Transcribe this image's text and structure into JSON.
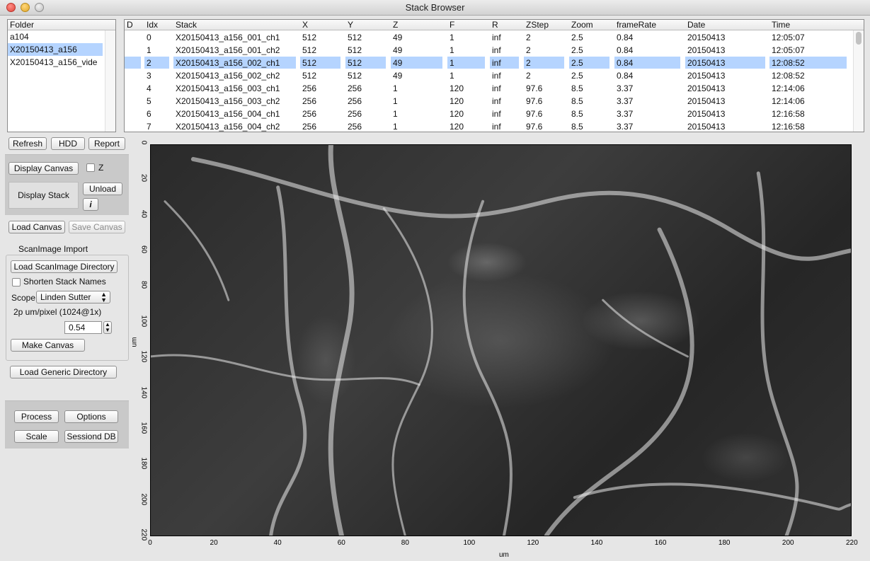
{
  "window": {
    "title": "Stack Browser"
  },
  "folders": {
    "header": "Folder",
    "items": [
      {
        "label": "a104",
        "selected": false
      },
      {
        "label": "X20150413_a156",
        "selected": true
      },
      {
        "label": "X20150413_a156_vide",
        "selected": false
      }
    ]
  },
  "table": {
    "columns": [
      "D",
      "Idx",
      "Stack",
      "X",
      "Y",
      "Z",
      "F",
      "R",
      "ZStep",
      "Zoom",
      "frameRate",
      "Date",
      "Time"
    ],
    "rows": [
      {
        "D": "",
        "Idx": "0",
        "Stack": "X20150413_a156_001_ch1",
        "X": "512",
        "Y": "512",
        "Z": "49",
        "F": "1",
        "R": "inf",
        "ZStep": "2",
        "Zoom": "2.5",
        "frameRate": "0.84",
        "Date": "20150413",
        "Time": "12:05:07",
        "selected": false
      },
      {
        "D": "",
        "Idx": "1",
        "Stack": "X20150413_a156_001_ch2",
        "X": "512",
        "Y": "512",
        "Z": "49",
        "F": "1",
        "R": "inf",
        "ZStep": "2",
        "Zoom": "2.5",
        "frameRate": "0.84",
        "Date": "20150413",
        "Time": "12:05:07",
        "selected": false
      },
      {
        "D": "",
        "Idx": "2",
        "Stack": "X20150413_a156_002_ch1",
        "X": "512",
        "Y": "512",
        "Z": "49",
        "F": "1",
        "R": "inf",
        "ZStep": "2",
        "Zoom": "2.5",
        "frameRate": "0.84",
        "Date": "20150413",
        "Time": "12:08:52",
        "selected": true
      },
      {
        "D": "",
        "Idx": "3",
        "Stack": "X20150413_a156_002_ch2",
        "X": "512",
        "Y": "512",
        "Z": "49",
        "F": "1",
        "R": "inf",
        "ZStep": "2",
        "Zoom": "2.5",
        "frameRate": "0.84",
        "Date": "20150413",
        "Time": "12:08:52",
        "selected": false
      },
      {
        "D": "",
        "Idx": "4",
        "Stack": "X20150413_a156_003_ch1",
        "X": "256",
        "Y": "256",
        "Z": "1",
        "F": "120",
        "R": "inf",
        "ZStep": "97.6",
        "Zoom": "8.5",
        "frameRate": "3.37",
        "Date": "20150413",
        "Time": "12:14:06",
        "selected": false
      },
      {
        "D": "",
        "Idx": "5",
        "Stack": "X20150413_a156_003_ch2",
        "X": "256",
        "Y": "256",
        "Z": "1",
        "F": "120",
        "R": "inf",
        "ZStep": "97.6",
        "Zoom": "8.5",
        "frameRate": "3.37",
        "Date": "20150413",
        "Time": "12:14:06",
        "selected": false
      },
      {
        "D": "",
        "Idx": "6",
        "Stack": "X20150413_a156_004_ch1",
        "X": "256",
        "Y": "256",
        "Z": "1",
        "F": "120",
        "R": "inf",
        "ZStep": "97.6",
        "Zoom": "8.5",
        "frameRate": "3.37",
        "Date": "20150413",
        "Time": "12:16:58",
        "selected": false
      },
      {
        "D": "",
        "Idx": "7",
        "Stack": "X20150413_a156_004_ch2",
        "X": "256",
        "Y": "256",
        "Z": "1",
        "F": "120",
        "R": "inf",
        "ZStep": "97.6",
        "Zoom": "8.5",
        "frameRate": "3.37",
        "Date": "20150413",
        "Time": "12:16:58",
        "selected": false
      }
    ]
  },
  "controls": {
    "refresh": "Refresh",
    "hdd": "HDD",
    "report": "Report",
    "display_canvas": "Display Canvas",
    "z_checkbox": "Z",
    "display_stack": "Display Stack",
    "unload": "Unload",
    "info": "i",
    "load_canvas": "Load Canvas",
    "save_canvas": "Save Canvas",
    "scanimage_title": "ScanImage Import",
    "load_scanimage_dir": "Load ScanImage Directory",
    "shorten_names": "Shorten Stack Names",
    "scope_label": "Scope",
    "scope_value": "Linden Sutter",
    "um_per_pixel_label": "2p um/pixel (1024@1x)",
    "um_per_pixel_value": "0.54",
    "make_canvas": "Make Canvas",
    "load_generic_dir": "Load Generic Directory",
    "process": "Process",
    "options": "Options",
    "scale": "Scale",
    "session_db": "Sessiond DB"
  },
  "plot": {
    "xlabel": "um",
    "ylabel": "um",
    "xticks": [
      "0",
      "20",
      "40",
      "60",
      "80",
      "100",
      "120",
      "140",
      "160",
      "180",
      "200",
      "220"
    ],
    "yticks": [
      "0",
      "20",
      "40",
      "60",
      "80",
      "100",
      "120",
      "140",
      "160",
      "180",
      "200",
      "220"
    ],
    "xlim": [
      0,
      220
    ],
    "ylim": [
      220,
      0
    ],
    "image_description": "grayscale two-photon vasculature stack"
  }
}
